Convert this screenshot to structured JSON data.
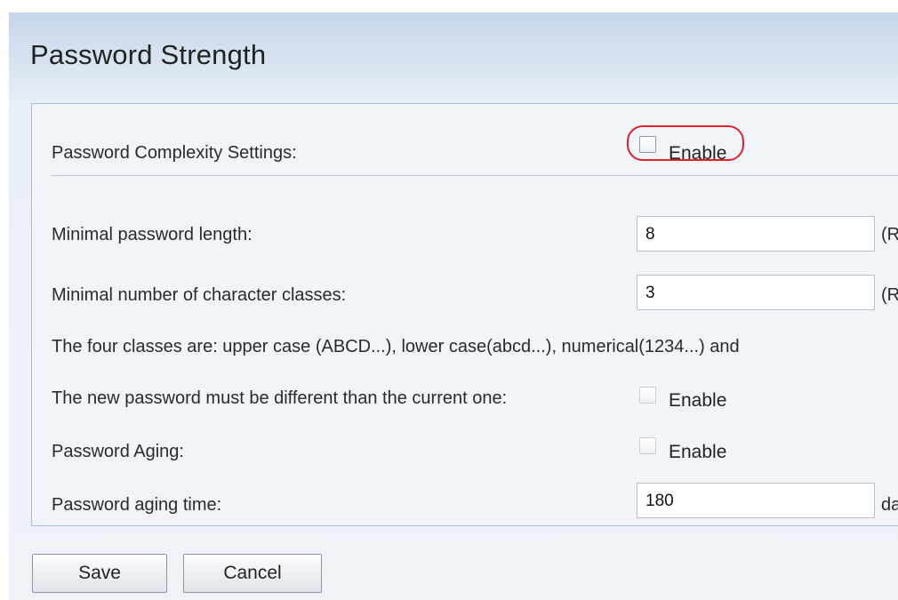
{
  "page": {
    "title": "Password Strength"
  },
  "form": {
    "complexity": {
      "label": "Password Complexity Settings:",
      "checkbox_label": "Enable",
      "checked": false
    },
    "min_length": {
      "label": "Minimal password length:",
      "value": "8",
      "suffix": "(R"
    },
    "min_classes": {
      "label": "Minimal number of character classes:",
      "value": "3",
      "suffix": "(R"
    },
    "classes_note": "The four classes are: upper case (ABCD...), lower case(abcd...), numerical(1234...) and",
    "different_password": {
      "label": "The new password must be different than the current one:",
      "checkbox_label": "Enable",
      "checked": false
    },
    "aging": {
      "label": "Password Aging:",
      "checkbox_label": "Enable",
      "checked": false
    },
    "aging_time": {
      "label": "Password aging time:",
      "value": "180",
      "suffix": "da"
    }
  },
  "buttons": {
    "save": "Save",
    "cancel": "Cancel"
  },
  "colors": {
    "highlight": "#e0202a",
    "background": "#eef3f8",
    "border": "#a9bdd4"
  }
}
